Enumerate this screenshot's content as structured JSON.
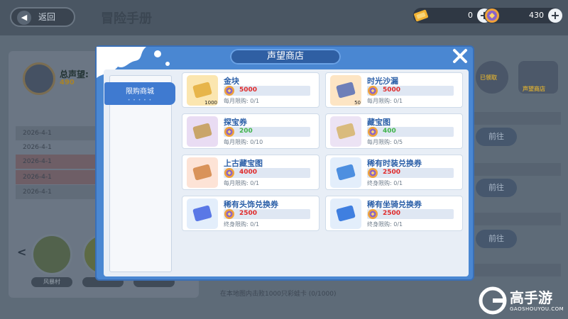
{
  "background": {
    "back_label": "返回",
    "title": "冒险手册",
    "reputation_label": "总声望:",
    "reputation_value": "490",
    "log_rows": [
      "2026-4-1",
      "2026-4-1",
      "2026-4-1",
      "2026-4-1",
      "2026-4-1"
    ],
    "locations": [
      "风暴村"
    ],
    "go_label": "前往",
    "bottom_text": "在本地图内击败1000只彩蛙卡 (0/1000)",
    "badge_left": "已领取",
    "badge_right": "声望商店"
  },
  "currency": [
    {
      "icon": "gold-ticket-icon",
      "value": "0"
    },
    {
      "icon": "reputation-coin-icon",
      "value": "430"
    }
  ],
  "modal": {
    "title": "声望商店",
    "tabs": [
      {
        "label": "限购商城",
        "active": true
      }
    ],
    "items": [
      {
        "name": "金块",
        "icon": "gold-bar-icon",
        "qty": "1000",
        "price": "5000",
        "price_color": "red",
        "limit": "每月限购: 0/1"
      },
      {
        "name": "时光沙漏",
        "icon": "hourglass-icon",
        "qty": "50",
        "price": "5000",
        "price_color": "red",
        "limit": "每月限购: 0/1"
      },
      {
        "name": "探宝券",
        "icon": "treasure-ticket-icon",
        "qty": "",
        "price": "200",
        "price_color": "green",
        "limit": "每月限购: 0/10"
      },
      {
        "name": "藏宝图",
        "icon": "treasure-map-icon",
        "qty": "",
        "price": "400",
        "price_color": "green",
        "limit": "每月限购: 0/5"
      },
      {
        "name": "上古藏宝图",
        "icon": "ancient-map-icon",
        "qty": "",
        "price": "4000",
        "price_color": "red",
        "limit": "每月限购: 0/1"
      },
      {
        "name": "稀有时装兑换券",
        "icon": "costume-coupon-icon",
        "qty": "",
        "price": "2500",
        "price_color": "red",
        "limit": "终身限购: 0/1"
      },
      {
        "name": "稀有头饰兑换券",
        "icon": "headwear-coupon-icon",
        "qty": "",
        "price": "2500",
        "price_color": "red",
        "limit": "终身限购: 0/1"
      },
      {
        "name": "稀有坐骑兑换券",
        "icon": "mount-coupon-icon",
        "qty": "",
        "price": "2500",
        "price_color": "red",
        "limit": "终身限购: 0/1"
      }
    ]
  },
  "watermark": {
    "brand": "高手游",
    "url": "GAOSHOUYOU.COM"
  }
}
